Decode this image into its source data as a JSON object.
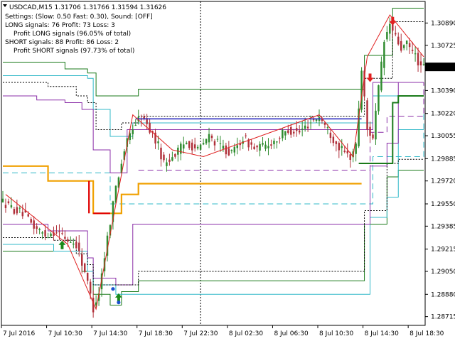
{
  "chart_data": {
    "type": "candlestick",
    "title": "USDCAD,M15  1.31706 1.31766 1.31594 1.31626",
    "title_symbol": "USDCAD,M15",
    "info_lines": [
      "Settings: (Slow: 0.50 Fast: 0.30), Sound: [OFF]",
      "LONG signals: 76 Profit: 73 Loss: 3",
      "Profit LONG signals (96.05% of total)",
      "SHORT signals: 88 Profit: 86 Loss: 2",
      "Profit SHORT signals (97.73% of total)"
    ],
    "ylim": [
      1.2865,
      1.3105
    ],
    "grid": false,
    "last_price": 1.30565,
    "y_ticks": [
      "1.30890",
      "1.30725",
      "1.30565",
      "1.30390",
      "1.30220",
      "1.30055",
      "1.29885",
      "1.29720",
      "1.29550",
      "1.29385",
      "1.29215",
      "1.29050",
      "1.28880",
      "1.28715"
    ],
    "x_ticks": [
      "7 Jul 2016",
      "7 Jul 10:30",
      "7 Jul 14:30",
      "7 Jul 18:30",
      "7 Jul 22:30",
      "8 Jul 02:30",
      "8 Jul 06:30",
      "8 Jul 10:30",
      "8 Jul 14:30",
      "8 Jul 18:30"
    ],
    "x_tick_pos": [
      0,
      16,
      32,
      48,
      64,
      80,
      96,
      112,
      128,
      144
    ],
    "num_bars": 150,
    "vline_bar": 70,
    "colors": {
      "bull": "#2e8b2e",
      "bear": "#b0303a",
      "zigzag": "#e02020",
      "blue_line": "#3030c0",
      "orange": "#f0a000",
      "purple": "#8b2fa8",
      "cyan": "#30b8c8",
      "dark_green": "#1a7a1a",
      "black_dot": "#000000",
      "signal_up": "#1a8a1a",
      "signal_down": "#e02020",
      "blue_dot": "#1a50d0"
    },
    "price_path": [
      [
        0,
        1.2958
      ],
      [
        4,
        1.2952
      ],
      [
        8,
        1.2948
      ],
      [
        12,
        1.2938
      ],
      [
        16,
        1.2932
      ],
      [
        20,
        1.2935
      ],
      [
        24,
        1.2928
      ],
      [
        27,
        1.2925
      ],
      [
        30,
        1.2905
      ],
      [
        33,
        1.2878
      ],
      [
        35,
        1.289
      ],
      [
        38,
        1.293
      ],
      [
        41,
        1.2968
      ],
      [
        44,
        1.2995
      ],
      [
        47,
        1.3012
      ],
      [
        50,
        1.302
      ],
      [
        53,
        1.301
      ],
      [
        56,
        1.2998
      ],
      [
        58,
        1.2985
      ],
      [
        62,
        1.2992
      ],
      [
        66,
        1.3001
      ],
      [
        70,
        1.2995
      ],
      [
        74,
        1.3005
      ],
      [
        78,
        1.2998
      ],
      [
        82,
        1.2992
      ],
      [
        86,
        1.3004
      ],
      [
        90,
        1.2996
      ],
      [
        94,
        1.2998
      ],
      [
        98,
        1.3003
      ],
      [
        102,
        1.301
      ],
      [
        106,
        1.3008
      ],
      [
        110,
        1.3016
      ],
      [
        113,
        1.302
      ],
      [
        116,
        1.301
      ],
      [
        119,
        1.3
      ],
      [
        122,
        1.2992
      ],
      [
        124,
        1.299
      ],
      [
        126,
        1.2998
      ],
      [
        128,
        1.3055
      ],
      [
        130,
        1.301
      ],
      [
        132,
        1.3005
      ],
      [
        134,
        1.304
      ],
      [
        136,
        1.3075
      ],
      [
        138,
        1.3088
      ],
      [
        140,
        1.3078
      ],
      [
        142,
        1.307
      ],
      [
        144,
        1.3073
      ],
      [
        147,
        1.3065
      ],
      [
        149,
        1.3056
      ]
    ],
    "zigzag": [
      [
        1,
        1.2962
      ],
      [
        23,
        1.2925
      ],
      [
        33,
        1.2877
      ],
      [
        46,
        1.3021
      ],
      [
        60,
        1.2995
      ],
      [
        71,
        1.299
      ],
      [
        112,
        1.3021
      ],
      [
        124,
        1.299
      ],
      [
        129,
        1.3064
      ],
      [
        137,
        1.3095
      ],
      [
        149,
        1.3064
      ]
    ],
    "blue_line": [
      [
        47,
        1.3018
      ],
      [
        127,
        1.3018
      ]
    ],
    "orange_line": [
      [
        0,
        1.2983
      ],
      [
        12,
        1.2983
      ],
      [
        16,
        1.2972
      ],
      [
        30,
        1.2972
      ],
      [
        32,
        1.2948
      ],
      [
        38,
        1.2948
      ],
      [
        42,
        1.2962
      ],
      [
        48,
        1.297
      ],
      [
        127,
        1.297
      ]
    ],
    "purple_solid_upper": [
      [
        0,
        1.3035
      ],
      [
        12,
        1.3032
      ],
      [
        22,
        1.303
      ],
      [
        28,
        1.3025
      ],
      [
        32,
        1.2995
      ],
      [
        38,
        1.2978
      ],
      [
        44,
        1.301
      ],
      [
        127,
        1.301
      ],
      [
        131,
        1.3045
      ],
      [
        149,
        1.3045
      ]
    ],
    "purple_solid_lower": [
      [
        0,
        1.294
      ],
      [
        16,
        1.2935
      ],
      [
        30,
        1.2915
      ],
      [
        32,
        1.29
      ],
      [
        40,
        1.2895
      ],
      [
        46,
        1.294
      ],
      [
        127,
        1.294
      ],
      [
        130,
        1.2983
      ],
      [
        136,
        1.3
      ],
      [
        140,
        1.3045
      ],
      [
        149,
        1.3045
      ]
    ],
    "purple_dash": [
      [
        48,
        1.298
      ],
      [
        127,
        1.298
      ],
      [
        130,
        1.3008
      ],
      [
        136,
        1.302
      ],
      [
        149,
        1.3045
      ]
    ],
    "cyan_solid_upper": [
      [
        0,
        1.305
      ],
      [
        20,
        1.305
      ],
      [
        30,
        1.3048
      ],
      [
        32,
        1.3025
      ],
      [
        38,
        1.3005
      ],
      [
        46,
        1.3015
      ],
      [
        127,
        1.3015
      ],
      [
        131,
        1.3035
      ],
      [
        149,
        1.3035
      ]
    ],
    "cyan_solid_lower": [
      [
        0,
        1.2925
      ],
      [
        18,
        1.292
      ],
      [
        30,
        1.2905
      ],
      [
        32,
        1.2895
      ],
      [
        40,
        1.2888
      ],
      [
        46,
        1.2888
      ],
      [
        127,
        1.2888
      ],
      [
        130,
        1.2945
      ],
      [
        136,
        1.296
      ],
      [
        140,
        1.301
      ],
      [
        149,
        1.301
      ]
    ],
    "cyan_dash": [
      [
        0,
        1.2978
      ],
      [
        20,
        1.2978
      ],
      [
        38,
        1.2955
      ],
      [
        127,
        1.2955
      ],
      [
        131,
        1.299
      ],
      [
        149,
        1.3022
      ]
    ],
    "green_upper": [
      [
        0,
        1.306
      ],
      [
        18,
        1.306
      ],
      [
        22,
        1.3055
      ],
      [
        30,
        1.3052
      ],
      [
        33,
        1.3035
      ],
      [
        42,
        1.3035
      ],
      [
        48,
        1.304
      ],
      [
        126,
        1.304
      ],
      [
        128,
        1.3065
      ],
      [
        136,
        1.3065
      ],
      [
        138,
        1.31
      ],
      [
        149,
        1.31
      ]
    ],
    "green_lower": [
      [
        0,
        1.292
      ],
      [
        20,
        1.292
      ],
      [
        28,
        1.2905
      ],
      [
        32,
        1.2888
      ],
      [
        38,
        1.288
      ],
      [
        42,
        1.289
      ],
      [
        48,
        1.2898
      ],
      [
        126,
        1.2898
      ],
      [
        128,
        1.294
      ],
      [
        134,
        1.294
      ],
      [
        136,
        1.2975
      ],
      [
        140,
        1.298
      ],
      [
        149,
        1.298
      ]
    ],
    "dark_green_thick": [
      [
        126,
        1.2985
      ],
      [
        132,
        1.2985
      ],
      [
        138,
        1.303
      ],
      [
        140,
        1.3035
      ],
      [
        149,
        1.3035
      ]
    ],
    "black_dotted_upper": [
      [
        0,
        1.3045
      ],
      [
        16,
        1.3042
      ],
      [
        26,
        1.3035
      ],
      [
        30,
        1.303
      ],
      [
        33,
        1.301
      ],
      [
        42,
        1.3015
      ],
      [
        48,
        1.302
      ],
      [
        126,
        1.302
      ],
      [
        128,
        1.3048
      ],
      [
        132,
        1.3048
      ],
      [
        138,
        1.309
      ],
      [
        149,
        1.309
      ]
    ],
    "black_dotted_lower": [
      [
        0,
        1.293
      ],
      [
        18,
        1.2928
      ],
      [
        26,
        1.2918
      ],
      [
        30,
        1.291
      ],
      [
        32,
        1.2895
      ],
      [
        40,
        1.2895
      ],
      [
        48,
        1.2905
      ],
      [
        126,
        1.2905
      ],
      [
        128,
        1.295
      ],
      [
        132,
        1.295
      ],
      [
        136,
        1.2985
      ],
      [
        140,
        1.2988
      ],
      [
        149,
        1.2988
      ]
    ],
    "signals_up": [
      [
        21,
        1.2923
      ],
      [
        41,
        1.2884
      ]
    ],
    "signals_down": [
      [
        130,
        1.305
      ],
      [
        138,
        1.3092
      ]
    ],
    "blue_dots": [
      [
        39,
        1.2892
      ],
      [
        41,
        1.2882
      ]
    ]
  }
}
